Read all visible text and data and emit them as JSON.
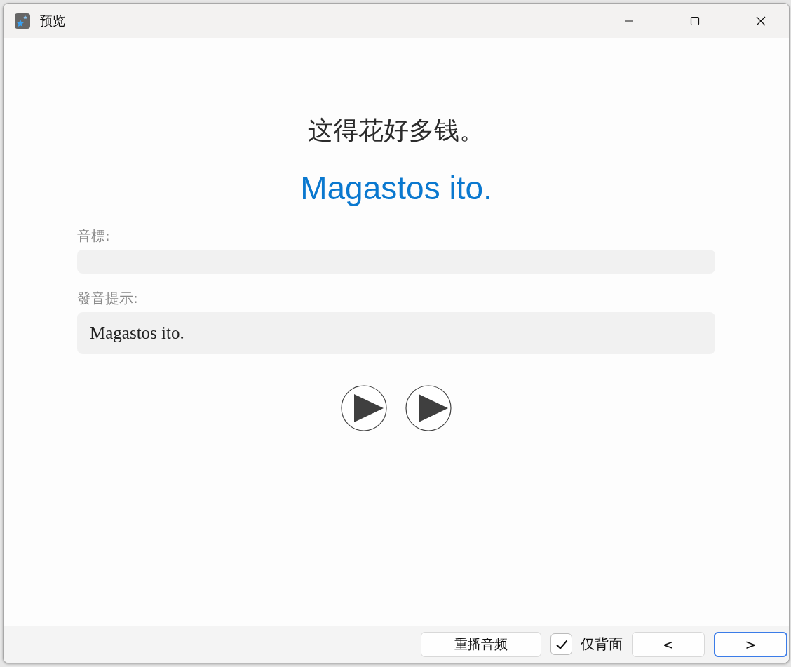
{
  "window": {
    "title": "预览"
  },
  "card": {
    "front": "这得花好多钱。",
    "back": "Magastos ito.",
    "fields": [
      {
        "label": "音標:"
      },
      {
        "label": "發音提示:",
        "value": "Magastos ito."
      }
    ]
  },
  "footer": {
    "replay_button": "重播音频",
    "back_only": {
      "label": "仅背面",
      "checked": true
    },
    "nav": [
      {
        "label": "<",
        "focused": false
      },
      {
        "label": ">",
        "focused": true
      }
    ]
  }
}
